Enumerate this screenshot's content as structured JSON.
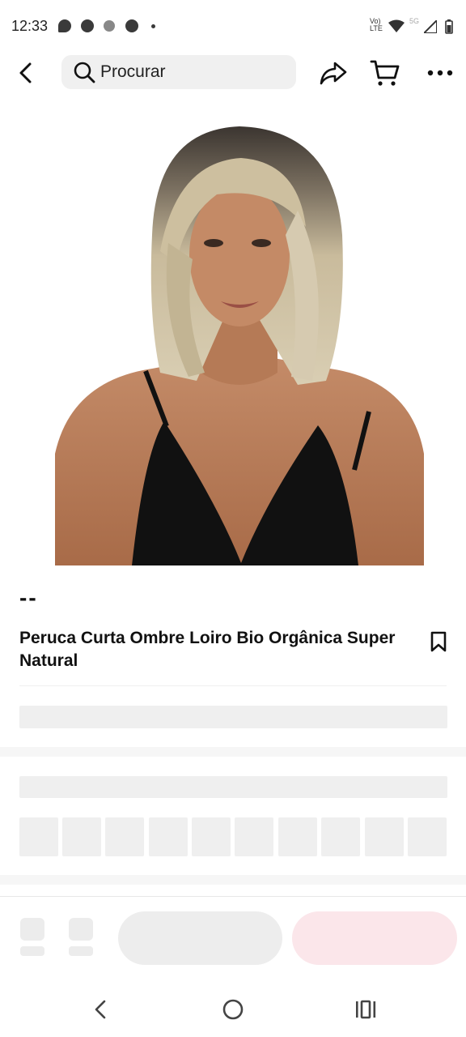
{
  "status_bar": {
    "time": "12:33",
    "network_label": "Vo) LTE",
    "signal_label": "5G"
  },
  "top_nav": {
    "search_placeholder": "Procurar",
    "icons": [
      "back-arrow-icon",
      "search-icon",
      "share-icon",
      "cart-icon",
      "more-icon"
    ]
  },
  "product": {
    "price": "--",
    "title": "Peruca Curta Ombre Loiro Bio Orgânica Super Natural",
    "image_subject": "woman wearing short blonde ombre bob wig and black top"
  },
  "colors": {
    "skeleton": "#efefef",
    "buy_button": "#fbe6ea",
    "add_button": "#ededed"
  },
  "system_nav": {
    "icons": [
      "nav-back-icon",
      "nav-home-icon",
      "nav-recents-icon"
    ]
  }
}
